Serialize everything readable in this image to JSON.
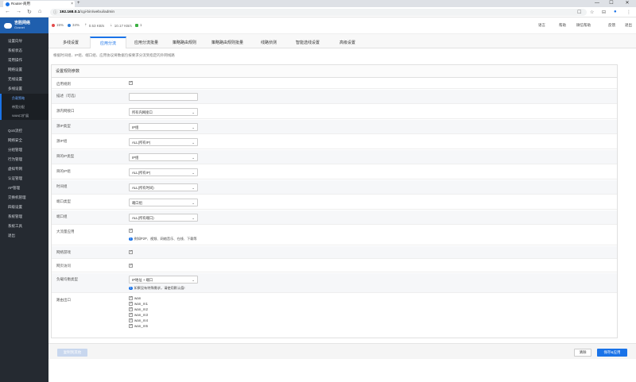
{
  "browser": {
    "tab_title": "Router-商用",
    "tab_close": "×",
    "new_tab": "+",
    "address_prefix": "192.168.0.1",
    "address_path": "/cgi-bin/webui/admin",
    "address_info": "ⓘ",
    "win_min": "—",
    "win_max": "☐",
    "win_close": "✕",
    "nav_back": "←",
    "nav_forward": "→",
    "nav_reload": "↻",
    "nav_home": "⌂",
    "tb_reader": "☐",
    "tb_star": "☆",
    "tb_ext": "⊟",
    "tb_profile": "●",
    "tb_menu": "⋮"
  },
  "logo": {
    "name": "吉胜网络",
    "sub": "Gosnet"
  },
  "sidebar": {
    "items": [
      {
        "label": "设置向导"
      },
      {
        "label": "系统状态"
      },
      {
        "label": "常用操作"
      },
      {
        "label": "网络设置"
      },
      {
        "label": "无线设置"
      },
      {
        "label": "多线设置"
      },
      {
        "label": "负载策略"
      },
      {
        "label": "带宽分配"
      },
      {
        "label": "WAN口扩展"
      },
      {
        "label": "QoS流控"
      },
      {
        "label": "网络安全"
      },
      {
        "label": "分组管理"
      },
      {
        "label": "行为管理"
      },
      {
        "label": "虚拟专网"
      },
      {
        "label": "认证管理"
      },
      {
        "label": "AP管理"
      },
      {
        "label": "交换机管理"
      },
      {
        "label": "四级设置"
      },
      {
        "label": "系统管理"
      },
      {
        "label": "系统工具"
      },
      {
        "label": "退出"
      }
    ]
  },
  "header": {
    "cpu": "15%",
    "mem": "34%",
    "up": "0.53 KB/s",
    "down": "10.17 KB/s",
    "users": "1",
    "language": "语言",
    "help": "帮助",
    "wechat": "微信帮助",
    "feedback": "反馈",
    "logout": "退出"
  },
  "tabs": [
    {
      "label": "多线设置"
    },
    {
      "label": "应用分流"
    },
    {
      "label": "应用分流批量"
    },
    {
      "label": "策略路由规则"
    },
    {
      "label": "策略路由规则批量"
    },
    {
      "label": "线路侦测"
    },
    {
      "label": "智能选线设置"
    },
    {
      "label": "高级设置"
    }
  ],
  "description": "根据时间组、IP组、端口组、应用协议将数据包按要求分流到指定的外网线路",
  "form": {
    "title": "设置规则参数",
    "rows": [
      {
        "label": "启用规则"
      },
      {
        "label": "描述（可选）",
        "value": ""
      },
      {
        "label": "源内网接口",
        "value": "所有内网接口"
      },
      {
        "label": "源IP类型",
        "value": "IP组"
      },
      {
        "label": "源IP组",
        "value": "ALL(所有IP)"
      },
      {
        "label": "目的IP类型",
        "value": "IP组"
      },
      {
        "label": "目的IP组",
        "value": "ALL(所有IP)"
      },
      {
        "label": "时间组",
        "value": "ALL(所有时间)"
      },
      {
        "label": "端口类型",
        "value": "端口组"
      },
      {
        "label": "端口组",
        "value": "ALL(所有端口)"
      },
      {
        "label": "大流量应用",
        "hint": "例如P2P、视频、网络音乐、在线、下载等"
      },
      {
        "label": "网络游戏"
      },
      {
        "label": "网页访问"
      },
      {
        "label": "负载均衡类型",
        "value": "IP地址 + 端口",
        "hint": "如果没有特殊需求，请使用默认值!"
      },
      {
        "label": "路由出口"
      }
    ],
    "wans": [
      "wan",
      "wan_m1",
      "wan_m2",
      "wan_m3",
      "wan_m4",
      "wan_m5"
    ],
    "caret": "⌄"
  },
  "footer": {
    "copy": "复制到其他",
    "clear": "清除",
    "save": "保存&应用"
  }
}
